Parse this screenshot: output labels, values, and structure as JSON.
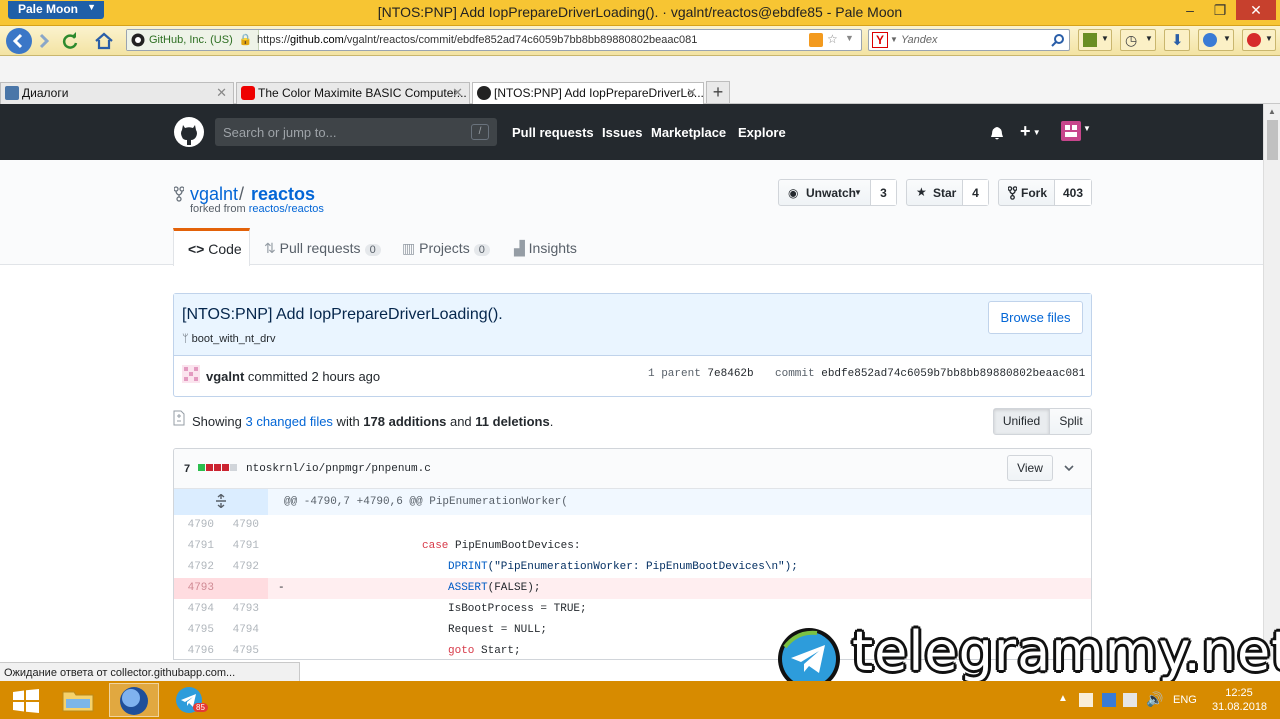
{
  "browser": {
    "app_menu": "Pale Moon",
    "window_title": "[NTOS:PNP] Add IopPrepareDriverLoading(). · vgalnt/reactos@ebdfe85 - Pale Moon",
    "identity": "GitHub, Inc. (US)",
    "url_prefix": "https://",
    "url_host": "github.com",
    "url_path": "/vgalnt/reactos/commit/ebdfe852ad74c6059b7bb8bb89880802beaac081",
    "search_placeholder": "Yandex",
    "status_text": "Ожидание ответа от collector.githubapp.com...",
    "tabs": [
      {
        "label": "Диалоги"
      },
      {
        "label": "The Color Maximite BASIC Computer..."
      },
      {
        "label": "[NTOS:PNP] Add IopPrepareDriverLo..."
      }
    ]
  },
  "github": {
    "search_placeholder": "Search or jump to...",
    "search_key": "/",
    "nav": [
      "Pull requests",
      "Issues",
      "Marketplace",
      "Explore"
    ],
    "plus": "+",
    "repo": {
      "owner": "vgalnt",
      "slash": "/",
      "name": "reactos",
      "forked_prefix": "forked from ",
      "forked_link": "reactos/reactos",
      "watch_label": "Unwatch",
      "watch_count": "3",
      "star_label": "Star",
      "star_count": "4",
      "fork_label": "Fork",
      "fork_count": "403"
    },
    "reponav": {
      "code": "Code",
      "pulls": "Pull requests",
      "pulls_count": "0",
      "projects": "Projects",
      "projects_count": "0",
      "insights": "Insights"
    },
    "commit": {
      "title": "[NTOS:PNP] Add IopPrepareDriverLoading().",
      "branch": "boot_with_nt_drv",
      "browse_files": "Browse files",
      "author": "vgalnt",
      "committed": " committed 2 hours ago",
      "parent_label": "1 parent ",
      "parent_sha": "7e8462b",
      "commit_label": "commit ",
      "commit_sha": "ebdfe852ad74c6059b7bb8bb89880802beaac081"
    },
    "toc": {
      "showing": "Showing ",
      "changed_files": "3 changed files",
      "with": " with ",
      "additions": "178 additions",
      "and": " and ",
      "deletions": "11 deletions",
      "period": ".",
      "unified": "Unified",
      "split": "Split"
    },
    "file": {
      "changes": "7",
      "path": "ntoskrnl/io/pnpmgr/pnpenum.c",
      "view": "View",
      "hunk": "@@ -4790,7 +4790,6 @@ PipEnumerationWorker(",
      "lines": [
        {
          "old": "4790",
          "new": "4790",
          "sign": "",
          "code": ""
        },
        {
          "old": "4791",
          "new": "4791",
          "sign": "",
          "kw": "case",
          "code": " PipEnumBootDevices:"
        },
        {
          "old": "4792",
          "new": "4792",
          "sign": "",
          "fn": "DPRINT",
          "code": "(\"PipEnumerationWorker: PipEnumBootDevices\\n\");"
        },
        {
          "old": "4793",
          "new": "",
          "sign": "-",
          "fn": "ASSERT",
          "code": "(FALSE);"
        },
        {
          "old": "4794",
          "new": "4793",
          "sign": "",
          "code": "IsBootProcess = TRUE;"
        },
        {
          "old": "4795",
          "new": "4794",
          "sign": "",
          "code": "Request = NULL;"
        },
        {
          "old": "4796",
          "new": "4795",
          "sign": "",
          "kw": "goto",
          "code": " Start;"
        }
      ]
    }
  },
  "watermark": "telegrammy.net",
  "taskbar": {
    "telegram_badge": "85",
    "lang": "ENG",
    "time": "12:25",
    "date": "31.08.2018"
  },
  "colors": {
    "titlebar": "#f7c533",
    "github_header": "#24292e",
    "link": "#0366d6",
    "taskbar": "#d78b00",
    "diff_deleted": "#ffeef0"
  }
}
